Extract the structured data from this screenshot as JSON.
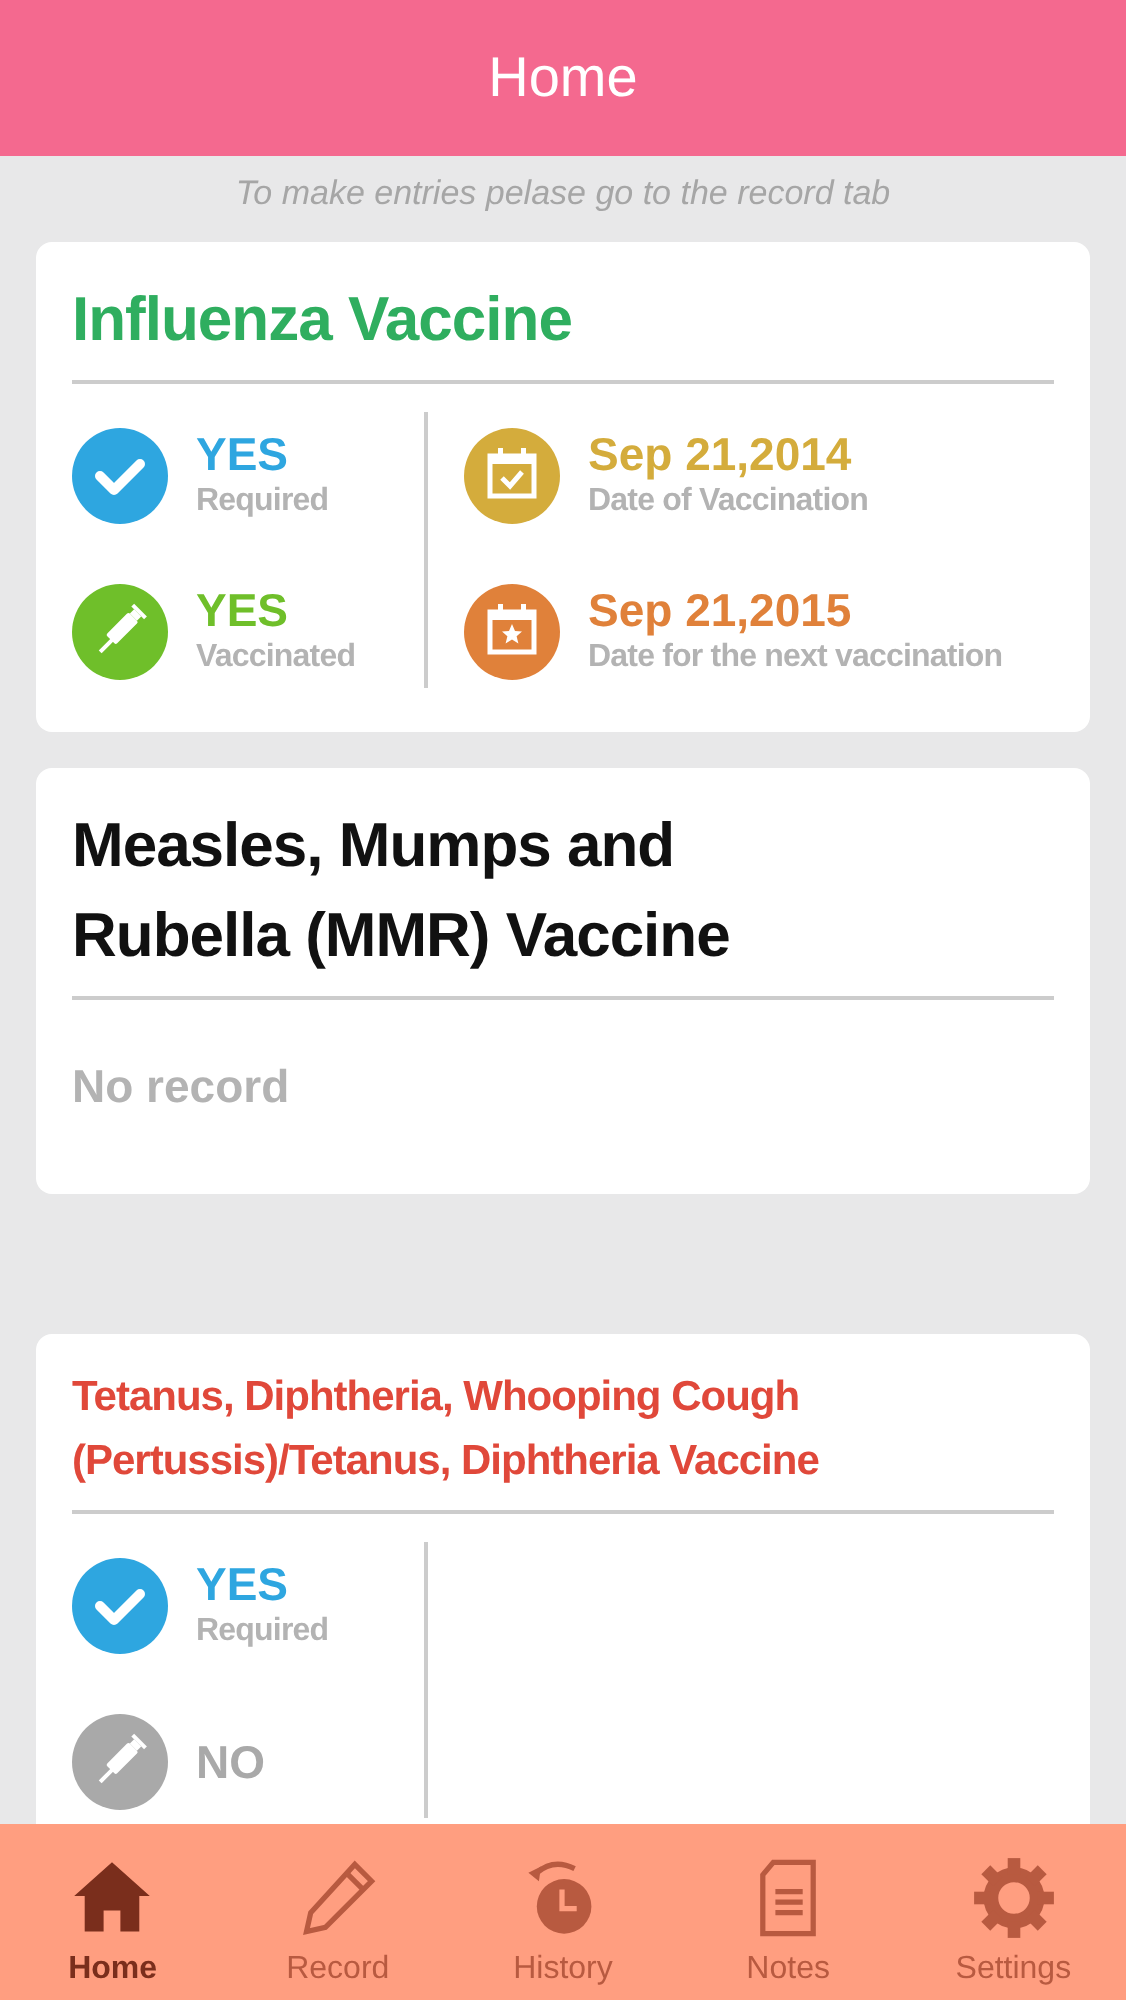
{
  "header": {
    "title": "Home"
  },
  "notice": "To make entries pelase go to the record tab",
  "vaccines": [
    {
      "title": "Influenza Vaccine",
      "color": "#2fae5f",
      "kind": "large",
      "statuses": [
        {
          "kind": "required",
          "value": "YES",
          "label": "Required",
          "done": true
        },
        {
          "kind": "vaccinated",
          "value": "YES",
          "label": "Vaccinated",
          "done": true
        }
      ],
      "dates": [
        {
          "kind": "vaccination",
          "date": "Sep 21,2014",
          "label": "Date of Vaccination"
        },
        {
          "kind": "next",
          "date": "Sep 21,2015",
          "label": "Date for the next vaccination"
        }
      ]
    },
    {
      "title": "Measles, Mumps and Rubella (MMR) Vaccine",
      "color": "#111111",
      "kind": "large",
      "no_record": "No record"
    },
    {
      "title": "Tetanus, Diphtheria, Whooping Cough (Pertussis)/Tetanus, Diphtheria Vaccine",
      "color": "#e0483a",
      "kind": "small",
      "statuses": [
        {
          "kind": "required",
          "value": "YES",
          "label": "Required",
          "done": true
        },
        {
          "kind": "vaccinated",
          "value": "NO",
          "done": false
        }
      ]
    }
  ],
  "tabs": [
    {
      "kind": "home",
      "label": "Home",
      "selected": true
    },
    {
      "kind": "record",
      "label": "Record",
      "selected": false
    },
    {
      "kind": "history",
      "label": "History",
      "selected": false
    },
    {
      "kind": "notes",
      "label": "Notes",
      "selected": false
    },
    {
      "kind": "settings",
      "label": "Settings",
      "selected": false
    }
  ]
}
